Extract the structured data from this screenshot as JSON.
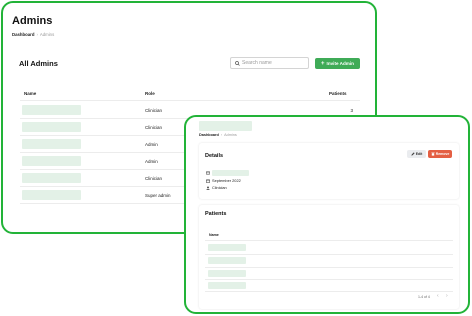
{
  "admins_page": {
    "title": "Admins",
    "breadcrumb": {
      "dashboard": "Dashboard",
      "separator": "›",
      "current": "Admins"
    },
    "card_title": "All Admins",
    "search": {
      "placeholder": "Search name",
      "value": ""
    },
    "invite_button": "Invite Admin",
    "table": {
      "headers": [
        "Name",
        "Role",
        "Patients"
      ],
      "rows": [
        {
          "role": "Clinician",
          "patients": "3"
        },
        {
          "role": "Clinician",
          "patients": ""
        },
        {
          "role": "Admin",
          "patients": ""
        },
        {
          "role": "Admin",
          "patients": ""
        },
        {
          "role": "Clinician",
          "patients": ""
        },
        {
          "role": "Super admin",
          "patients": ""
        }
      ]
    }
  },
  "detail_page": {
    "breadcrumb": {
      "dashboard": "Dashboard",
      "separator": "›",
      "current": "Admins"
    },
    "details": {
      "title": "Details",
      "edit_button": "Edit",
      "remove_button": "Remove",
      "date": "September 2022",
      "role": "Clinician"
    },
    "patients": {
      "title": "Patients",
      "column_header": "Name",
      "pagination": "1-4 of 4"
    }
  },
  "colors": {
    "accent_green": "#22b338",
    "button_green": "#3fab57",
    "danger": "#e45f43",
    "placeholder_fill": "#e3f1e7"
  }
}
